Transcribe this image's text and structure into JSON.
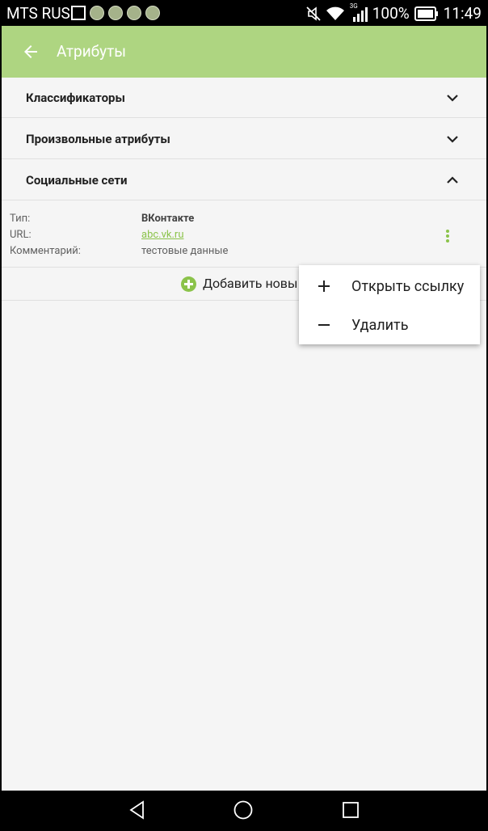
{
  "status_bar": {
    "carrier": "MTS RUS",
    "network": "3G",
    "battery": "100%",
    "time": "11:49"
  },
  "toolbar": {
    "title": "Атрибуты"
  },
  "sections": [
    {
      "label": "Классификаторы",
      "expanded": false
    },
    {
      "label": "Произвольные атрибуты",
      "expanded": false
    },
    {
      "label": "Социальные сети",
      "expanded": true
    }
  ],
  "entry": {
    "type_key": "Тип:",
    "type_value": "ВКонтакте",
    "url_key": "URL:",
    "url_value": "abc.vk.ru",
    "comment_key": "Комментарий:",
    "comment_value": "тестовые данные"
  },
  "add_row": {
    "label": "Добавить новы"
  },
  "popup_menu": {
    "items": [
      {
        "label": "Открыть ссылку",
        "icon": "plus-icon"
      },
      {
        "label": "Удалить",
        "icon": "minus-icon"
      }
    ]
  },
  "colors": {
    "toolbar": "#aed581",
    "accent": "#8bc34a",
    "background": "#f5f5f5"
  }
}
